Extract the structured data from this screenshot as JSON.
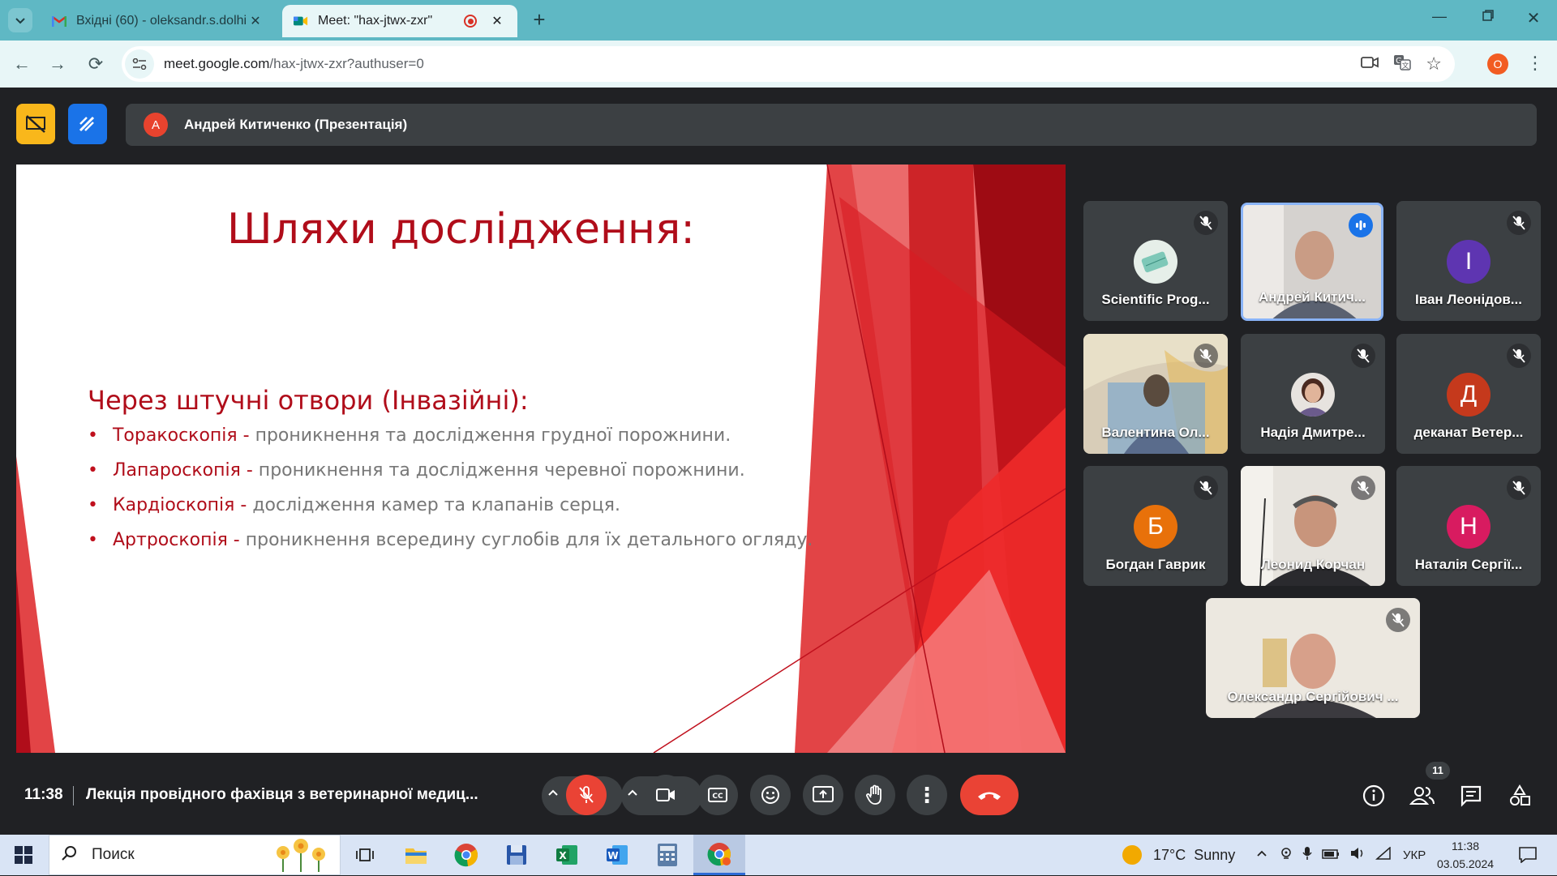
{
  "browser": {
    "tabs": [
      {
        "label": "Вхідні (60) - oleksandr.s.dolhin",
        "icon": "gmail-icon"
      },
      {
        "label": "Meet: \"hax-jtwx-zxr\"",
        "icon": "meet-icon"
      }
    ],
    "url_host": "meet.google.com",
    "url_path": "/hax-jtwx-zxr?authuser=0",
    "profile_initial": "O"
  },
  "meet": {
    "presenter_initial": "A",
    "presenter_label": "Андрей Китиченко (Презентація)",
    "time": "11:38",
    "meeting_title": "Лекція провідного фахівця з ветеринарної медиц...",
    "participant_count": "11",
    "accent": "#8ab4f8",
    "end_call_color": "#ea4335"
  },
  "slide": {
    "title": "Шляхи дослідження:",
    "heading": "Через штучні отвори (Інвазійні):",
    "bullets": [
      {
        "term": "Торакоскопія -",
        "text": " проникнення та дослідження грудної порожнини."
      },
      {
        "term": "Лапароскопія -",
        "text": " проникнення та дослідження черевної порожнини."
      },
      {
        "term": "Кардіоскопія -",
        "text": " дослідження камер та клапанів серця."
      },
      {
        "term": "Артроскопія -",
        "text": " проникнення всередину суглобів для їх детального огляду."
      }
    ]
  },
  "participants": [
    {
      "name": "Scientific Prog...",
      "kind": "logo"
    },
    {
      "name": "Андрей Китич...",
      "kind": "video",
      "speaking": true
    },
    {
      "name": "Іван Леонідов...",
      "initial": "І",
      "color": "#5e35b1"
    },
    {
      "name": "Валентина Ол...",
      "kind": "video"
    },
    {
      "name": "Надія Дмитре...",
      "kind": "photo"
    },
    {
      "name": "деканат Ветер...",
      "initial": "Д",
      "color": "#c5391c"
    },
    {
      "name": "Богдан Гаврик",
      "initial": "Б",
      "color": "#e8710a"
    },
    {
      "name": "Леонид Корчан",
      "kind": "video"
    },
    {
      "name": "Наталія Сергії...",
      "initial": "Н",
      "color": "#d81b60"
    },
    {
      "name": "Олександр Сергійович ...",
      "kind": "video"
    }
  ],
  "taskbar": {
    "search_placeholder": "Поиск",
    "weather": "17°C  Sunny",
    "lang": "УКР",
    "time": "11:38",
    "date": "03.05.2024"
  }
}
